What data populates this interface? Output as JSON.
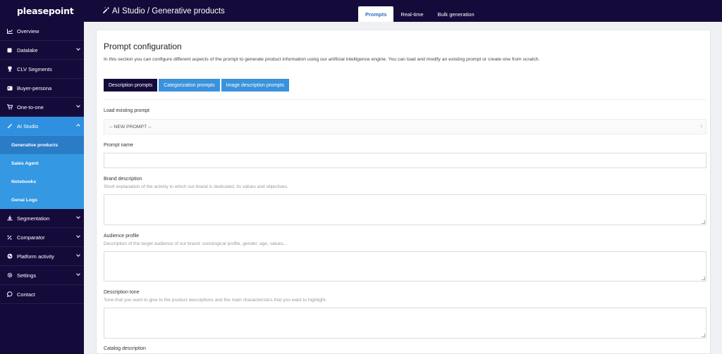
{
  "brand": {
    "logo": "pleasepoint"
  },
  "sidebar": {
    "items": [
      {
        "label": "Overview",
        "icon": "chart-icon"
      },
      {
        "label": "Datalake",
        "icon": "database-icon"
      },
      {
        "label": "CLV Segments",
        "icon": "trophy-icon"
      },
      {
        "label": "Buyer-persona",
        "icon": "id-card-icon"
      },
      {
        "label": "One-to-one",
        "icon": "cart-icon"
      },
      {
        "label": "AI Studio",
        "icon": "magic-wand-icon"
      },
      {
        "label": "Segmentation",
        "icon": "download-icon"
      },
      {
        "label": "Comparator",
        "icon": "percent-icon"
      },
      {
        "label": "Platform activity",
        "icon": "pulse-icon"
      },
      {
        "label": "Settings",
        "icon": "gear-icon"
      },
      {
        "label": "Contact",
        "icon": "chat-icon"
      }
    ],
    "ai_studio_sub": [
      "Generative products",
      "Sales Agent",
      "Notebooks",
      "Genai Logs"
    ]
  },
  "header": {
    "breadcrumb": "AI Studio / Generative products",
    "tabs": [
      "Prompts",
      "Real-time",
      "Bulk generation"
    ]
  },
  "main": {
    "title": "Prompt configuration",
    "intro": "In this section you can configure different aspects of the prompt to generate product information using our artificial intelligence engine. You can load and modify an existing prompt or create one from scratch.",
    "prompt_types": [
      "Description prompts",
      "Categorization prompts",
      "Image description prompts"
    ],
    "load_label": "Load existing prompt",
    "load_value": "-- NEW PROMPT --",
    "prompt_name_label": "Prompt name",
    "brand_label": "Brand description",
    "brand_hint": "Short explanation of the activity to which our brand is dedicated, its values and objectives.",
    "audience_label": "Audience profile",
    "audience_hint": "Description of the target audience of our brand: sociological profile, gender, age, values...",
    "tone_label": "Description tone",
    "tone_hint": "Tone that you want to give to the product descriptions and the main characteristics that you want to highlight.",
    "catalog_label": "Catalog description"
  },
  "colors": {
    "navy": "#140b3b",
    "accent": "#3498e2",
    "active_tab_text": "#2a6fba"
  }
}
